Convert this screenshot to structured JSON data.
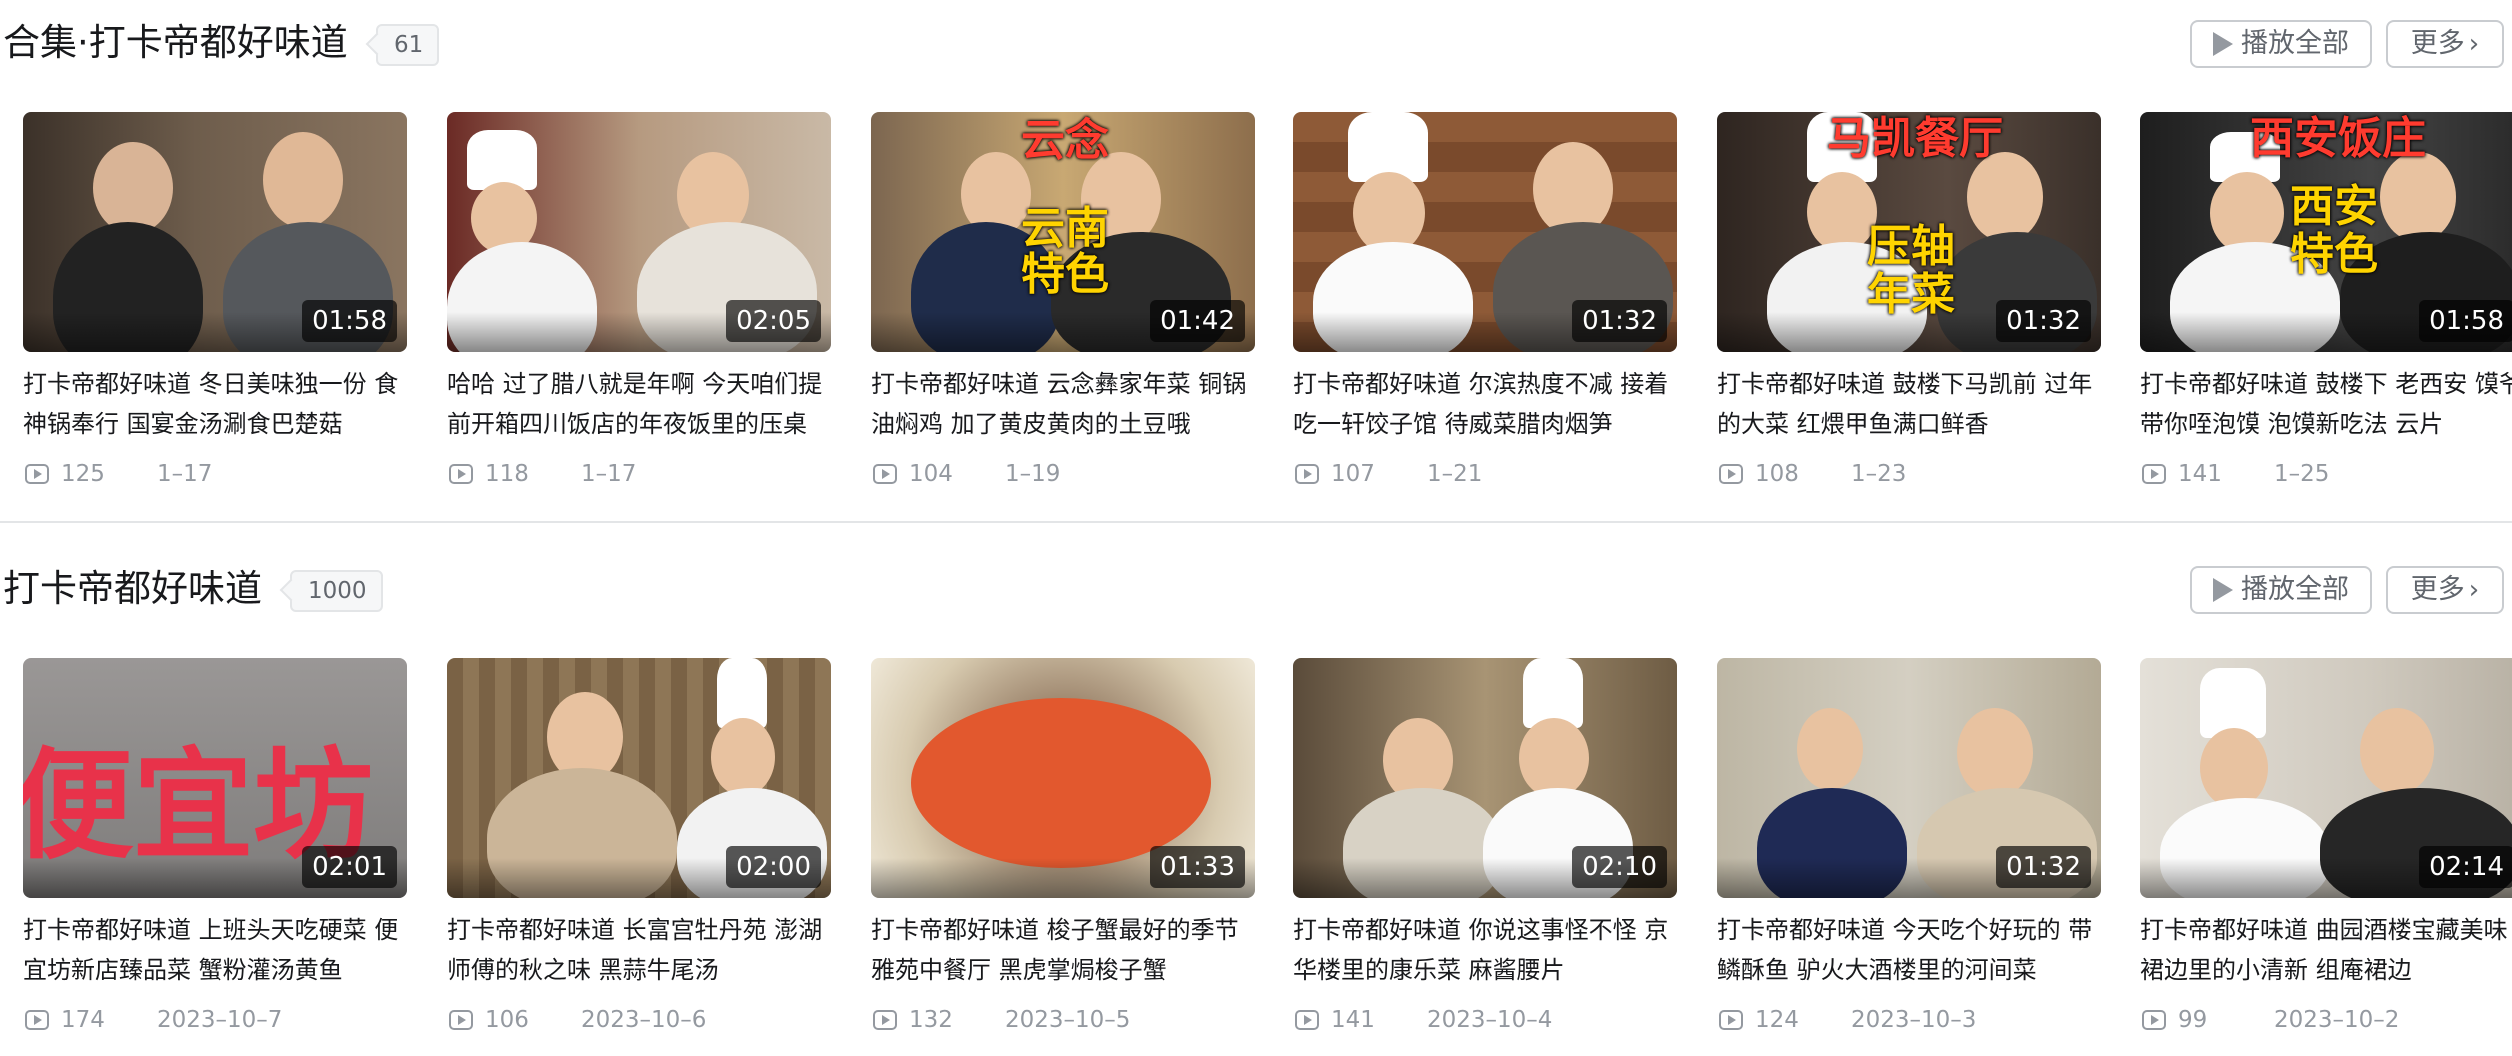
{
  "sections": [
    {
      "title": "合集·打卡帝都好味道",
      "count": "61",
      "play_all_label": "播放全部",
      "more_label": "更多",
      "videos": [
        {
          "duration": "01:58",
          "title": "打卡帝都好味道 冬日美味独一份 食神锅奉行 国宴金汤涮食巴楚菇",
          "views": "125",
          "date": "1–17",
          "thumb_color": "#6b5a4a"
        },
        {
          "duration": "02:05",
          "title": "哈哈 过了腊八就是年啊 今天咱们提前开箱四川饭店的年夜饭里的压桌",
          "views": "118",
          "date": "1–17",
          "thumb_color": "#b39a7e"
        },
        {
          "duration": "01:42",
          "title": "打卡帝都好味道 云念彝家年菜 铜锅油焖鸡 加了黄皮黄肉的土豆哦",
          "views": "104",
          "date": "1–19",
          "thumb_color": "#c8a873"
        },
        {
          "duration": "01:32",
          "title": "打卡帝都好味道 尔滨热度不减 接着吃一轩饺子馆 待威菜腊肉烟笋",
          "views": "107",
          "date": "1–21",
          "thumb_color": "#8a5a3a"
        },
        {
          "duration": "01:32",
          "title": "打卡帝都好味道 鼓楼下马凯前 过年的大菜 红煨甲鱼满口鲜香",
          "views": "108",
          "date": "1–23",
          "thumb_color": "#4a3b33"
        },
        {
          "duration": "01:58",
          "title": "打卡帝都好味道 鼓楼下 老西安 馍爷带你咥泡馍 泡馍新吃法 云片",
          "views": "141",
          "date": "1–25",
          "thumb_color": "#3a3a3a"
        }
      ]
    },
    {
      "title": "打卡帝都好味道",
      "count": "1000",
      "play_all_label": "播放全部",
      "more_label": "更多",
      "videos": [
        {
          "duration": "02:01",
          "title": "打卡帝都好味道 上班头天吃硬菜 便宜坊新店臻品菜 蟹粉灌汤黄鱼",
          "views": "174",
          "date": "2023–10–7",
          "thumb_color": "#8e8d8c"
        },
        {
          "duration": "02:00",
          "title": "打卡帝都好味道 长富宫牡丹苑 澎湖师傅的秋之味 黑蒜牛尾汤",
          "views": "106",
          "date": "2023–10–6",
          "thumb_color": "#9c8462"
        },
        {
          "duration": "01:33",
          "title": "打卡帝都好味道 梭子蟹最好的季节 雅苑中餐厅 黑虎掌焗梭子蟹",
          "views": "132",
          "date": "2023–10–5",
          "thumb_color": "#d4c6a4"
        },
        {
          "duration": "02:10",
          "title": "打卡帝都好味道 你说这事怪不怪 京华楼里的康乐菜 麻酱腰片",
          "views": "141",
          "date": "2023–10–4",
          "thumb_color": "#7d6a4c"
        },
        {
          "duration": "01:32",
          "title": "打卡帝都好味道 今天吃个好玩的 带鳞酥鱼 驴火大酒楼里的河间菜",
          "views": "124",
          "date": "2023–10–3",
          "thumb_color": "#c7c0ae"
        },
        {
          "duration": "02:14",
          "title": "打卡帝都好味道 曲园酒楼宝藏美味 裙边里的小清新 组庵裙边",
          "views": "99",
          "date": "2023–10–2",
          "thumb_color": "#cfcac1"
        }
      ]
    }
  ]
}
